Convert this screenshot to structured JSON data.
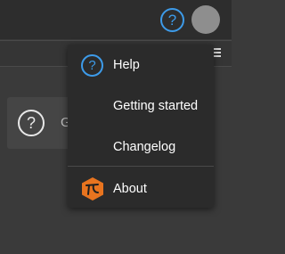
{
  "header": {
    "help_icon_glyph": "?",
    "avatar_color": "#8e8e8e",
    "accent_color": "#3d9be9"
  },
  "subbar": {
    "menu_icon": "hamburger-icon"
  },
  "card": {
    "icon_glyph": "?",
    "label": "G"
  },
  "menu": {
    "items": [
      {
        "label": "Help",
        "icon": "help-icon",
        "icon_glyph": "?"
      },
      {
        "label": "Getting started"
      },
      {
        "label": "Changelog"
      },
      {
        "label": "About",
        "icon": "about-logo-icon",
        "icon_color": "#e8741f"
      }
    ]
  }
}
